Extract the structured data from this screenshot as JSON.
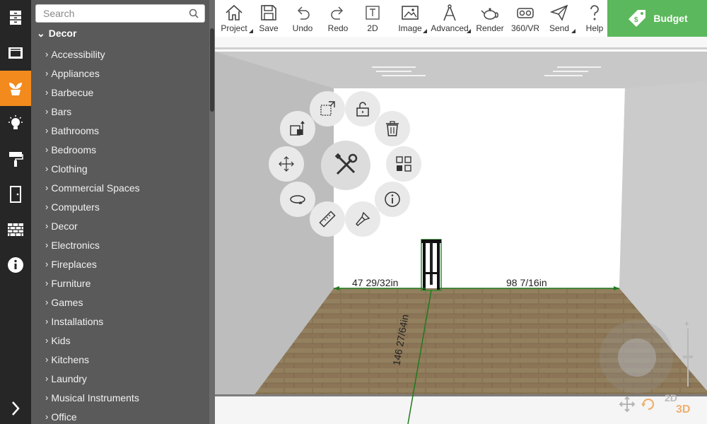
{
  "rail": {
    "items": [
      {
        "icon": "cabinet-icon"
      },
      {
        "icon": "oven-icon"
      },
      {
        "icon": "plant-icon",
        "active": true
      },
      {
        "icon": "lightbulb-icon"
      },
      {
        "icon": "paint-roller-icon"
      },
      {
        "icon": "door-icon"
      },
      {
        "icon": "brick-wall-icon"
      },
      {
        "icon": "info-icon"
      }
    ],
    "expand_icon": "chevron-right-icon",
    "active_color": "#f28a1d"
  },
  "catalog": {
    "search_placeholder": "Search",
    "root_chevron": "⌄",
    "root_label": "Decor",
    "item_chevron": "›",
    "items": [
      "Accessibility",
      "Appliances",
      "Barbecue",
      "Bars",
      "Bathrooms",
      "Bedrooms",
      "Clothing",
      "Commercial Spaces",
      "Computers",
      "Decor",
      "Electronics",
      "Fireplaces",
      "Furniture",
      "Games",
      "Installations",
      "Kids",
      "Kitchens",
      "Laundry",
      "Musical Instruments",
      "Office"
    ]
  },
  "toolbar": {
    "project": "Project",
    "save": "Save",
    "undo": "Undo",
    "redo": "Redo",
    "view2d": "2D",
    "image": "Image",
    "advanced": "Advanced",
    "render": "Render",
    "vr": "360/VR",
    "send": "Send",
    "help": "Help",
    "budget": "Budget",
    "budget_color": "#5cb85c"
  },
  "viewport": {
    "dim_left": "47 29/32in",
    "dim_right": "98 7/16in",
    "dim_depth": "146 27/64in",
    "dimension_color": "#1f7a1f",
    "view_2d": "2D",
    "view_3d": "3D"
  },
  "radial_menu": {
    "center": "tools-icon",
    "items": [
      "resize-icon",
      "unlock-icon",
      "trash-icon",
      "duplicate-icon",
      "info-icon",
      "paint-brush-icon",
      "ruler-icon",
      "rotate-icon",
      "move-icon",
      "elevation-icon"
    ]
  }
}
